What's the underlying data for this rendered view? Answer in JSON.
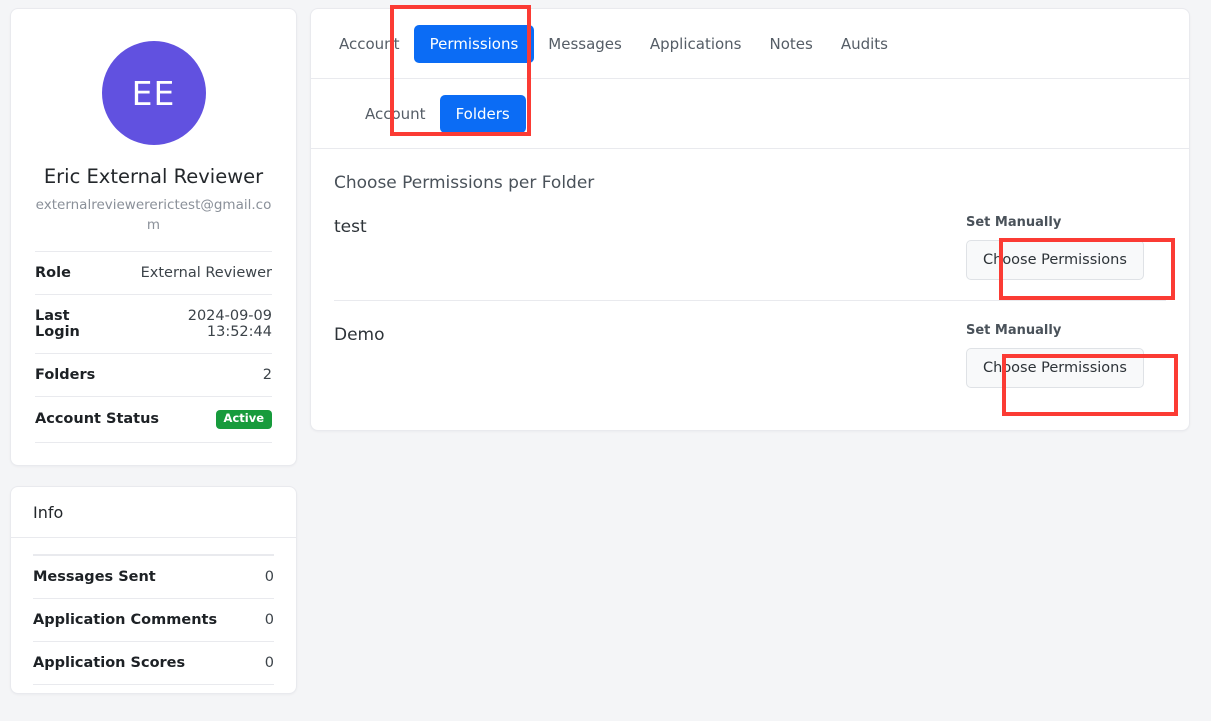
{
  "profile": {
    "avatar_initials": "EE",
    "name": "Eric External Reviewer",
    "email": "externalreviewererictest@gmail.com",
    "details": [
      {
        "label": "Role",
        "value": "External Reviewer"
      },
      {
        "label": "Last Login",
        "value": "2024-09-09 13:52:44"
      },
      {
        "label": "Folders",
        "value": "2"
      }
    ],
    "status_label": "Account Status",
    "status_value": "Active"
  },
  "info": {
    "title": "Info",
    "stats": [
      {
        "label": "Messages Sent",
        "value": "0"
      },
      {
        "label": "Application Comments",
        "value": "0"
      },
      {
        "label": "Application Scores",
        "value": "0"
      }
    ]
  },
  "tabs": [
    {
      "label": "Account",
      "active": false
    },
    {
      "label": "Permissions",
      "active": true
    },
    {
      "label": "Messages",
      "active": false
    },
    {
      "label": "Applications",
      "active": false
    },
    {
      "label": "Notes",
      "active": false
    },
    {
      "label": "Audits",
      "active": false
    }
  ],
  "subtabs": [
    {
      "label": "Account",
      "active": false
    },
    {
      "label": "Folders",
      "active": true
    }
  ],
  "panel": {
    "title": "Choose Permissions per Folder",
    "set_manually_label": "Set Manually",
    "choose_permissions_label": "Choose Permissions",
    "folders": [
      {
        "name": "test"
      },
      {
        "name": "Demo"
      }
    ]
  },
  "colors": {
    "avatar_purple": "#6151e0",
    "accent_blue": "#0b6cf5",
    "status_green": "#179b3c",
    "annotation_red": "#fb3b34",
    "page_background": "#f4f5f7"
  }
}
